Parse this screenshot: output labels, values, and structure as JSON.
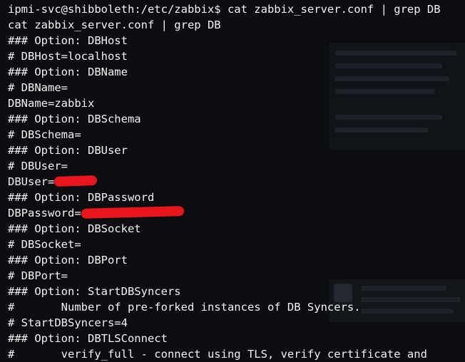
{
  "terminal": {
    "lines": [
      "ipmi-svc@shibboleth:/etc/zabbix$ cat zabbix_server.conf | grep DB",
      "cat zabbix_server.conf | grep DB",
      "### Option: DBHost",
      "# DBHost=localhost",
      "### Option: DBName",
      "# DBName=",
      "DBName=zabbix",
      "### Option: DBSchema",
      "# DBSchema=",
      "### Option: DBUser",
      "# DBUser=",
      "DBUser=",
      "### Option: DBPassword",
      "DBPassword=",
      "### Option: DBSocket",
      "# DBSocket=",
      "### Option: DBPort",
      "# DBPort=",
      "### Option: StartDBSyncers",
      "#       Number of pre-forked instances of DB Syncers.",
      "# StartDBSyncers=4",
      "### Option: DBTLSConnect",
      "#       verify_full - connect using TLS, verify certificate and"
    ]
  },
  "colors": {
    "background": "#0b0d10",
    "text": "#f2f2f2",
    "redaction": "#e8161c"
  }
}
